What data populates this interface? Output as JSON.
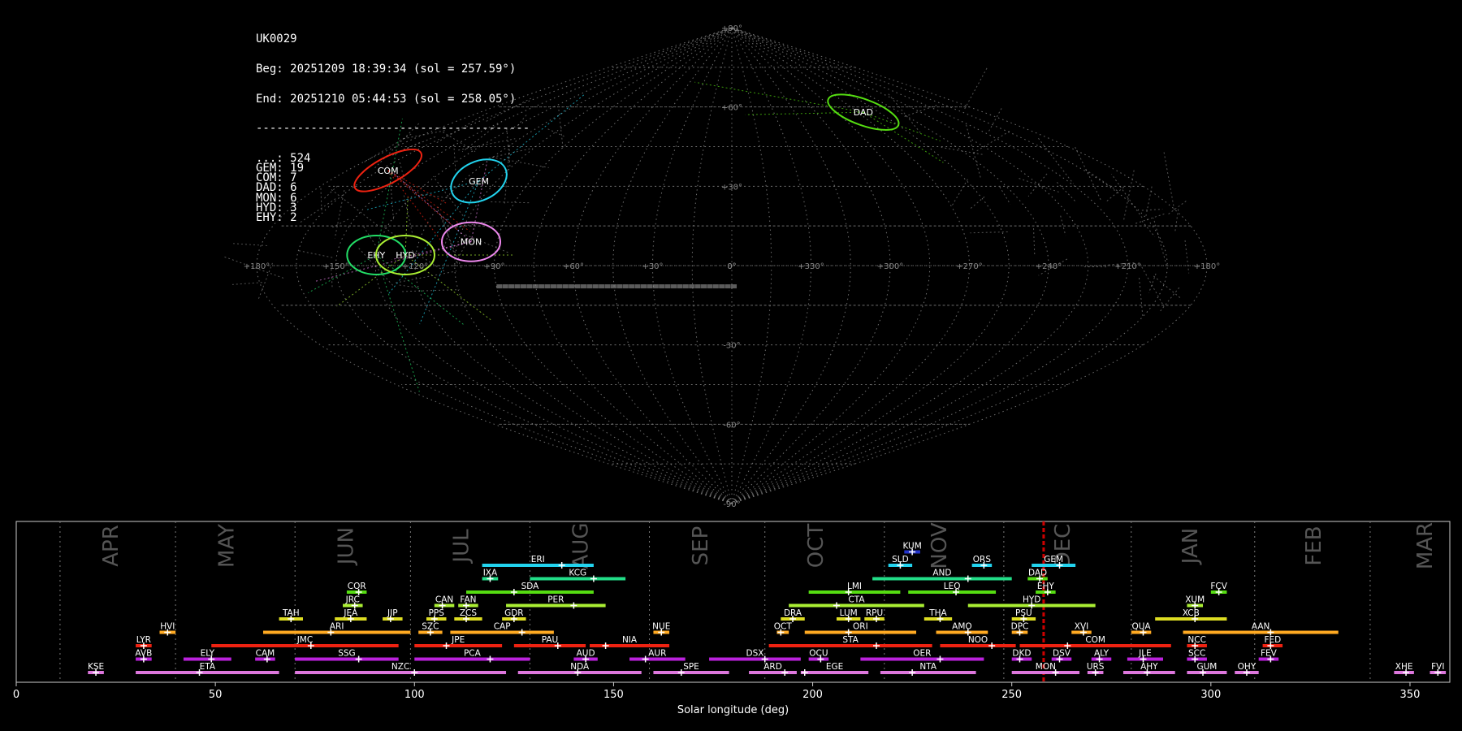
{
  "header": {
    "station": "UK0029",
    "begin": "Beg: 20251209 18:39:34 (sol = 257.59°)",
    "end": "End: 20251210 05:44:53 (sol = 258.05°)",
    "separator": "----------------------------------------",
    "counts": [
      {
        "label": "...",
        "value": 524
      },
      {
        "label": "GEM",
        "value": 19
      },
      {
        "label": "COM",
        "value": 7
      },
      {
        "label": "DAD",
        "value": 6
      },
      {
        "label": "MON",
        "value": 6
      },
      {
        "label": "HYD",
        "value": 3
      },
      {
        "label": "EHY",
        "value": 2
      }
    ]
  },
  "colors": {
    "background": "#000000",
    "grid": "#888888",
    "sporadic": "#bbbbbb",
    "GEM": "#22d3ee",
    "COM": "#ee2211",
    "DAD": "#55dd11",
    "MON": "#ee88ee",
    "HYD": "#aaee33",
    "EHY": "#22dd66",
    "current_sol": "#cc0000"
  },
  "chart_data": [
    {
      "type": "scatter",
      "projection": "sinusoidal",
      "lat_ticks": [
        "+90°",
        "+60°",
        "+30°",
        "0°",
        "-30°",
        "-60°",
        "-90°"
      ],
      "lon_ticks": [
        "+180°",
        "+150°",
        "+120°",
        "+90°",
        "+60°",
        "+30°",
        "0°",
        "+330°",
        "+300°",
        "+270°",
        "+240°",
        "+210°",
        "+180°"
      ],
      "radiants": [
        {
          "name": "DAD",
          "ra": 266,
          "dec": 58,
          "color": "#55dd11"
        },
        {
          "name": "COM",
          "ra": 161,
          "dec": 36,
          "color": "#ee2211"
        },
        {
          "name": "GEM",
          "ra": 113,
          "dec": 32,
          "color": "#22d3ee"
        },
        {
          "name": "MON",
          "ra": 100,
          "dec": 9,
          "color": "#ee88ee"
        },
        {
          "name": "EHY",
          "ra": 135,
          "dec": 4,
          "color": "#22dd66"
        },
        {
          "name": "HYD",
          "ra": 124,
          "dec": 4,
          "color": "#aaee33"
        }
      ]
    },
    {
      "type": "bar",
      "title": "",
      "xlabel": "Solar longitude (deg)",
      "xlim": [
        0,
        360
      ],
      "xticks": [
        0,
        50,
        100,
        150,
        200,
        250,
        300,
        350
      ],
      "current_sol": 258,
      "months": [
        {
          "name": "APR",
          "center": 24
        },
        {
          "name": "MAY",
          "center": 53
        },
        {
          "name": "JUN",
          "center": 83
        },
        {
          "name": "JUL",
          "center": 112
        },
        {
          "name": "AUG",
          "center": 142
        },
        {
          "name": "SEP",
          "center": 172
        },
        {
          "name": "OCT",
          "center": 201
        },
        {
          "name": "NOV",
          "center": 232
        },
        {
          "name": "DEC",
          "center": 263
        },
        {
          "name": "JAN",
          "center": 295
        },
        {
          "name": "FEB",
          "center": 326
        },
        {
          "name": "MAR",
          "center": 354
        }
      ],
      "month_boundaries": [
        11,
        40,
        70,
        99,
        129,
        159,
        188,
        218,
        248,
        280,
        311,
        340
      ],
      "showers": [
        {
          "code": "KUM",
          "start": 223,
          "end": 227,
          "peak": 225,
          "row": 10,
          "color": "#2233cc"
        },
        {
          "code": "ERI",
          "start": 117,
          "end": 145,
          "peak": 137,
          "row": 9,
          "color": "#22d3ee"
        },
        {
          "code": "SLD",
          "start": 219,
          "end": 225,
          "peak": 222,
          "row": 9,
          "color": "#22d3ee"
        },
        {
          "code": "ORS",
          "start": 240,
          "end": 245,
          "peak": 243,
          "row": 9,
          "color": "#22d3ee"
        },
        {
          "code": "GEM",
          "start": 255,
          "end": 266,
          "peak": 262,
          "row": 9,
          "color": "#22d3ee"
        },
        {
          "code": "IXA",
          "start": 117,
          "end": 121,
          "peak": 119,
          "row": 8,
          "color": "#22dd88"
        },
        {
          "code": "KCG",
          "start": 129,
          "end": 153,
          "peak": 145,
          "row": 8,
          "color": "#22dd88"
        },
        {
          "code": "AND",
          "start": 215,
          "end": 250,
          "peak": 239,
          "row": 8,
          "color": "#22dd88"
        },
        {
          "code": "DAD",
          "start": 254,
          "end": 259,
          "peak": 257,
          "row": 8,
          "color": "#55dd11"
        },
        {
          "code": "COR",
          "start": 83,
          "end": 88,
          "peak": 86,
          "row": 7,
          "color": "#55dd11"
        },
        {
          "code": "SDA",
          "start": 113,
          "end": 145,
          "peak": 125,
          "row": 7,
          "color": "#55dd11"
        },
        {
          "code": "LMI",
          "start": 199,
          "end": 222,
          "peak": 209,
          "row": 7,
          "color": "#55dd11"
        },
        {
          "code": "LEQ",
          "start": 224,
          "end": 246,
          "peak": 236,
          "row": 7,
          "color": "#55dd11"
        },
        {
          "code": "EHY",
          "start": 256,
          "end": 261,
          "peak": 259,
          "row": 7,
          "color": "#55dd11"
        },
        {
          "code": "FCV",
          "start": 300,
          "end": 304,
          "peak": 302,
          "row": 7,
          "color": "#55dd11"
        },
        {
          "code": "JRC",
          "start": 82,
          "end": 87,
          "peak": 85,
          "row": 6,
          "color": "#aaee33"
        },
        {
          "code": "CAN",
          "start": 105,
          "end": 110,
          "peak": 107,
          "row": 6,
          "color": "#aaee33"
        },
        {
          "code": "FAN",
          "start": 111,
          "end": 116,
          "peak": 113,
          "row": 6,
          "color": "#aaee33"
        },
        {
          "code": "PER",
          "start": 123,
          "end": 148,
          "peak": 140,
          "row": 6,
          "color": "#aaee33"
        },
        {
          "code": "CTA",
          "start": 194,
          "end": 228,
          "peak": 206,
          "row": 6,
          "color": "#aaee33"
        },
        {
          "code": "HYD",
          "start": 239,
          "end": 271,
          "peak": 255,
          "row": 6,
          "color": "#aaee33"
        },
        {
          "code": "XUM",
          "start": 294,
          "end": 298,
          "peak": 296,
          "row": 6,
          "color": "#aaee33"
        },
        {
          "code": "TAH",
          "start": 66,
          "end": 72,
          "peak": 69,
          "row": 5,
          "color": "#dddd22"
        },
        {
          "code": "JEA",
          "start": 80,
          "end": 88,
          "peak": 84,
          "row": 5,
          "color": "#dddd22"
        },
        {
          "code": "JIP",
          "start": 92,
          "end": 97,
          "peak": 94,
          "row": 5,
          "color": "#dddd22"
        },
        {
          "code": "PPS",
          "start": 103,
          "end": 108,
          "peak": 105,
          "row": 5,
          "color": "#dddd22"
        },
        {
          "code": "ZCS",
          "start": 110,
          "end": 117,
          "peak": 113,
          "row": 5,
          "color": "#dddd22"
        },
        {
          "code": "GDR",
          "start": 122,
          "end": 128,
          "peak": 125,
          "row": 5,
          "color": "#dddd22"
        },
        {
          "code": "DRA",
          "start": 192,
          "end": 198,
          "peak": 195,
          "row": 5,
          "color": "#dddd22"
        },
        {
          "code": "LUM",
          "start": 206,
          "end": 212,
          "peak": 209,
          "row": 5,
          "color": "#dddd22"
        },
        {
          "code": "RPU",
          "start": 213,
          "end": 218,
          "peak": 216,
          "row": 5,
          "color": "#dddd22"
        },
        {
          "code": "THA",
          "start": 228,
          "end": 235,
          "peak": 232,
          "row": 5,
          "color": "#dddd22"
        },
        {
          "code": "PSU",
          "start": 250,
          "end": 256,
          "peak": 253,
          "row": 5,
          "color": "#dddd22"
        },
        {
          "code": "XCB",
          "start": 286,
          "end": 304,
          "peak": 296,
          "row": 5,
          "color": "#dddd22"
        },
        {
          "code": "HVI",
          "start": 36,
          "end": 40,
          "peak": 38,
          "row": 4,
          "color": "#ffaa22"
        },
        {
          "code": "ARI",
          "start": 62,
          "end": 99,
          "peak": 79,
          "row": 4,
          "color": "#ffaa22"
        },
        {
          "code": "SZC",
          "start": 101,
          "end": 107,
          "peak": 104,
          "row": 4,
          "color": "#ffaa22"
        },
        {
          "code": "CAP",
          "start": 109,
          "end": 135,
          "peak": 127,
          "row": 4,
          "color": "#ffaa22"
        },
        {
          "code": "NUE",
          "start": 160,
          "end": 164,
          "peak": 162,
          "row": 4,
          "color": "#ffaa22"
        },
        {
          "code": "OCT",
          "start": 191,
          "end": 194,
          "peak": 192,
          "row": 4,
          "color": "#ffaa22"
        },
        {
          "code": "ORI",
          "start": 198,
          "end": 226,
          "peak": 209,
          "row": 4,
          "color": "#ffaa22"
        },
        {
          "code": "AMO",
          "start": 231,
          "end": 244,
          "peak": 239,
          "row": 4,
          "color": "#ffaa22"
        },
        {
          "code": "DPC",
          "start": 250,
          "end": 254,
          "peak": 252,
          "row": 4,
          "color": "#ffaa22"
        },
        {
          "code": "XVI",
          "start": 265,
          "end": 270,
          "peak": 268,
          "row": 4,
          "color": "#ffaa22"
        },
        {
          "code": "QUA",
          "start": 280,
          "end": 285,
          "peak": 283,
          "row": 4,
          "color": "#ffaa22"
        },
        {
          "code": "AAN",
          "start": 293,
          "end": 332,
          "peak": 315,
          "row": 4,
          "color": "#ffaa22"
        },
        {
          "code": "LYR",
          "start": 30,
          "end": 34,
          "peak": 32,
          "row": 3,
          "color": "#ee2211"
        },
        {
          "code": "JMC",
          "start": 49,
          "end": 96,
          "peak": 74,
          "row": 3,
          "color": "#ee2211"
        },
        {
          "code": "JPE",
          "start": 100,
          "end": 122,
          "peak": 108,
          "row": 3,
          "color": "#ee2211"
        },
        {
          "code": "PAU",
          "start": 125,
          "end": 143,
          "peak": 136,
          "row": 3,
          "color": "#ee2211"
        },
        {
          "code": "NIA",
          "start": 144,
          "end": 164,
          "peak": 148,
          "row": 3,
          "color": "#ee2211"
        },
        {
          "code": "STA",
          "start": 189,
          "end": 230,
          "peak": 216,
          "row": 3,
          "color": "#ee2211"
        },
        {
          "code": "NOO",
          "start": 232,
          "end": 251,
          "peak": 245,
          "row": 3,
          "color": "#ee2211"
        },
        {
          "code": "COM",
          "start": 252,
          "end": 290,
          "peak": 264,
          "row": 3,
          "color": "#ee2211"
        },
        {
          "code": "NCC",
          "start": 294,
          "end": 299,
          "peak": 296,
          "row": 3,
          "color": "#ee2211"
        },
        {
          "code": "FED",
          "start": 313,
          "end": 318,
          "peak": 315,
          "row": 3,
          "color": "#ee2211"
        },
        {
          "code": "AVB",
          "start": 30,
          "end": 34,
          "peak": 32,
          "row": 2,
          "color": "#bb22dd"
        },
        {
          "code": "ELY",
          "start": 42,
          "end": 54,
          "peak": 49,
          "row": 2,
          "color": "#bb22dd"
        },
        {
          "code": "CAM",
          "start": 60,
          "end": 65,
          "peak": 63,
          "row": 2,
          "color": "#bb22dd"
        },
        {
          "code": "SSG",
          "start": 70,
          "end": 96,
          "peak": 86,
          "row": 2,
          "color": "#bb22dd"
        },
        {
          "code": "PCA",
          "start": 100,
          "end": 129,
          "peak": 119,
          "row": 2,
          "color": "#bb22dd"
        },
        {
          "code": "AUD",
          "start": 140,
          "end": 146,
          "peak": 143,
          "row": 2,
          "color": "#bb22dd"
        },
        {
          "code": "AUR",
          "start": 154,
          "end": 168,
          "peak": 158,
          "row": 2,
          "color": "#bb22dd"
        },
        {
          "code": "DSX",
          "start": 174,
          "end": 197,
          "peak": 188,
          "row": 2,
          "color": "#bb22dd"
        },
        {
          "code": "OCU",
          "start": 199,
          "end": 204,
          "peak": 202,
          "row": 2,
          "color": "#bb22dd"
        },
        {
          "code": "OER",
          "start": 212,
          "end": 243,
          "peak": 232,
          "row": 2,
          "color": "#bb22dd"
        },
        {
          "code": "DKD",
          "start": 250,
          "end": 255,
          "peak": 252,
          "row": 2,
          "color": "#bb22dd"
        },
        {
          "code": "DSV",
          "start": 260,
          "end": 265,
          "peak": 262,
          "row": 2,
          "color": "#bb22dd"
        },
        {
          "code": "ALY",
          "start": 270,
          "end": 275,
          "peak": 272,
          "row": 2,
          "color": "#bb22dd"
        },
        {
          "code": "JLE",
          "start": 279,
          "end": 288,
          "peak": 283,
          "row": 2,
          "color": "#bb22dd"
        },
        {
          "code": "SCC",
          "start": 294,
          "end": 299,
          "peak": 296,
          "row": 2,
          "color": "#bb22dd"
        },
        {
          "code": "FEV",
          "start": 312,
          "end": 317,
          "peak": 315,
          "row": 2,
          "color": "#bb22dd"
        },
        {
          "code": "KSE",
          "start": 18,
          "end": 22,
          "peak": 20,
          "row": 1,
          "color": "#dd77dd"
        },
        {
          "code": "ETA",
          "start": 30,
          "end": 66,
          "peak": 46,
          "row": 1,
          "color": "#dd77dd"
        },
        {
          "code": "NZC",
          "start": 70,
          "end": 123,
          "peak": 100,
          "row": 1,
          "color": "#dd77dd"
        },
        {
          "code": "NDA",
          "start": 126,
          "end": 157,
          "peak": 141,
          "row": 1,
          "color": "#dd77dd"
        },
        {
          "code": "SPE",
          "start": 160,
          "end": 179,
          "peak": 167,
          "row": 1,
          "color": "#dd77dd"
        },
        {
          "code": "ARD",
          "start": 184,
          "end": 196,
          "peak": 193,
          "row": 1,
          "color": "#dd77dd"
        },
        {
          "code": "EGE",
          "start": 197,
          "end": 214,
          "peak": 198,
          "row": 1,
          "color": "#dd77dd"
        },
        {
          "code": "NTA",
          "start": 217,
          "end": 241,
          "peak": 225,
          "row": 1,
          "color": "#dd77dd"
        },
        {
          "code": "MON",
          "start": 250,
          "end": 267,
          "peak": 261,
          "row": 1,
          "color": "#dd77dd"
        },
        {
          "code": "URS",
          "start": 269,
          "end": 273,
          "peak": 271,
          "row": 1,
          "color": "#dd77dd"
        },
        {
          "code": "AHY",
          "start": 278,
          "end": 291,
          "peak": 284,
          "row": 1,
          "color": "#dd77dd"
        },
        {
          "code": "GUM",
          "start": 294,
          "end": 304,
          "peak": 298,
          "row": 1,
          "color": "#dd77dd"
        },
        {
          "code": "OHY",
          "start": 306,
          "end": 312,
          "peak": 309,
          "row": 1,
          "color": "#dd77dd"
        },
        {
          "code": "XHE",
          "start": 346,
          "end": 351,
          "peak": 349,
          "row": 1,
          "color": "#dd77dd"
        },
        {
          "code": "FVI",
          "start": 355,
          "end": 359,
          "peak": 357,
          "row": 1,
          "color": "#dd77dd"
        }
      ]
    }
  ]
}
